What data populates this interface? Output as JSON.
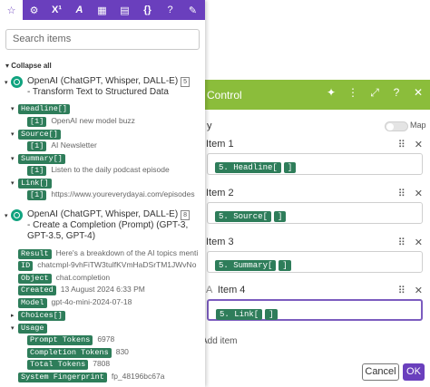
{
  "popup": {
    "tabs": [
      {
        "name": "star-icon",
        "glyph": "☆"
      },
      {
        "name": "gear-icon",
        "glyph": "⚙"
      },
      {
        "name": "math-icon",
        "glyph": "X¹"
      },
      {
        "name": "text-icon",
        "glyph": "A"
      },
      {
        "name": "calendar-icon",
        "glyph": "▦"
      },
      {
        "name": "table-icon",
        "glyph": "▤"
      },
      {
        "name": "braces-icon",
        "glyph": "{}"
      },
      {
        "name": "help-icon",
        "glyph": "?"
      },
      {
        "name": "edit-icon",
        "glyph": "✎"
      }
    ],
    "search_placeholder": "Search items",
    "collapse_all": "Collapse all",
    "module1": {
      "title_line1": "OpenAI (ChatGPT, Whisper, DALL-E)",
      "badge": "5",
      "title_line2": "- Transform Text to Structured Data",
      "headline": "Headline[]",
      "headline_idx": "[1]",
      "headline_val": "OpenAI new model buzz",
      "source": "Source[]",
      "source_idx": "[1]",
      "source_val": "AI Newsletter",
      "summary": "Summary[]",
      "summary_idx": "[1]",
      "summary_val": "Listen to the daily podcast episode",
      "link": "Link[]",
      "link_idx": "[1]",
      "link_val": "https://www.youreverydayai.com/episodes"
    },
    "module2": {
      "title_line1": "OpenAI (ChatGPT, Whisper, DALL-E)",
      "badge": "8",
      "title_line2": "- Create a Completion (Prompt) (GPT-3,",
      "title_line3": "GPT-3.5, GPT-4)",
      "fields": [
        {
          "key": "Result",
          "val": "Here's a breakdown of the AI topics menti"
        },
        {
          "key": "ID",
          "val": "chatcmpl-9vhFiTW3tulfKVmHaDSrTM1JWvNo"
        },
        {
          "key": "Object",
          "val": "chat.completion"
        },
        {
          "key": "Created",
          "val": "13 August 2024 6:33 PM"
        },
        {
          "key": "Model",
          "val": "gpt-4o-mini-2024-07-18"
        }
      ],
      "choices": "Choices[]",
      "usage": "Usage",
      "usage_fields": [
        {
          "key": "Prompt Tokens",
          "val": "6978"
        },
        {
          "key": "Completion Tokens",
          "val": "830"
        },
        {
          "key": "Total Tokens",
          "val": "7808"
        }
      ],
      "fingerprint_key": "System Fingerprint",
      "fingerprint_val": "fp_48196bc67a"
    }
  },
  "panel": {
    "title": "Control",
    "map_partial": "y",
    "map_label": "Map",
    "items": [
      {
        "label": "Item 1",
        "tokens": [
          "5. Headline[",
          "]"
        ]
      },
      {
        "label": "Item 2",
        "tokens": [
          "5. Source[",
          "]"
        ]
      },
      {
        "label": "Item 3",
        "tokens": [
          "5. Summary[",
          "]"
        ]
      },
      {
        "label": "Item 4",
        "prefix": "A",
        "tokens": [
          "5. Link[",
          "]"
        ]
      }
    ],
    "add_item": "Add item",
    "cancel": "Cancel",
    "ok": "OK"
  },
  "colors": {
    "purple": "#6a3fbd",
    "green_header": "#8bbd3b",
    "pill_green": "#2e7d5a"
  }
}
